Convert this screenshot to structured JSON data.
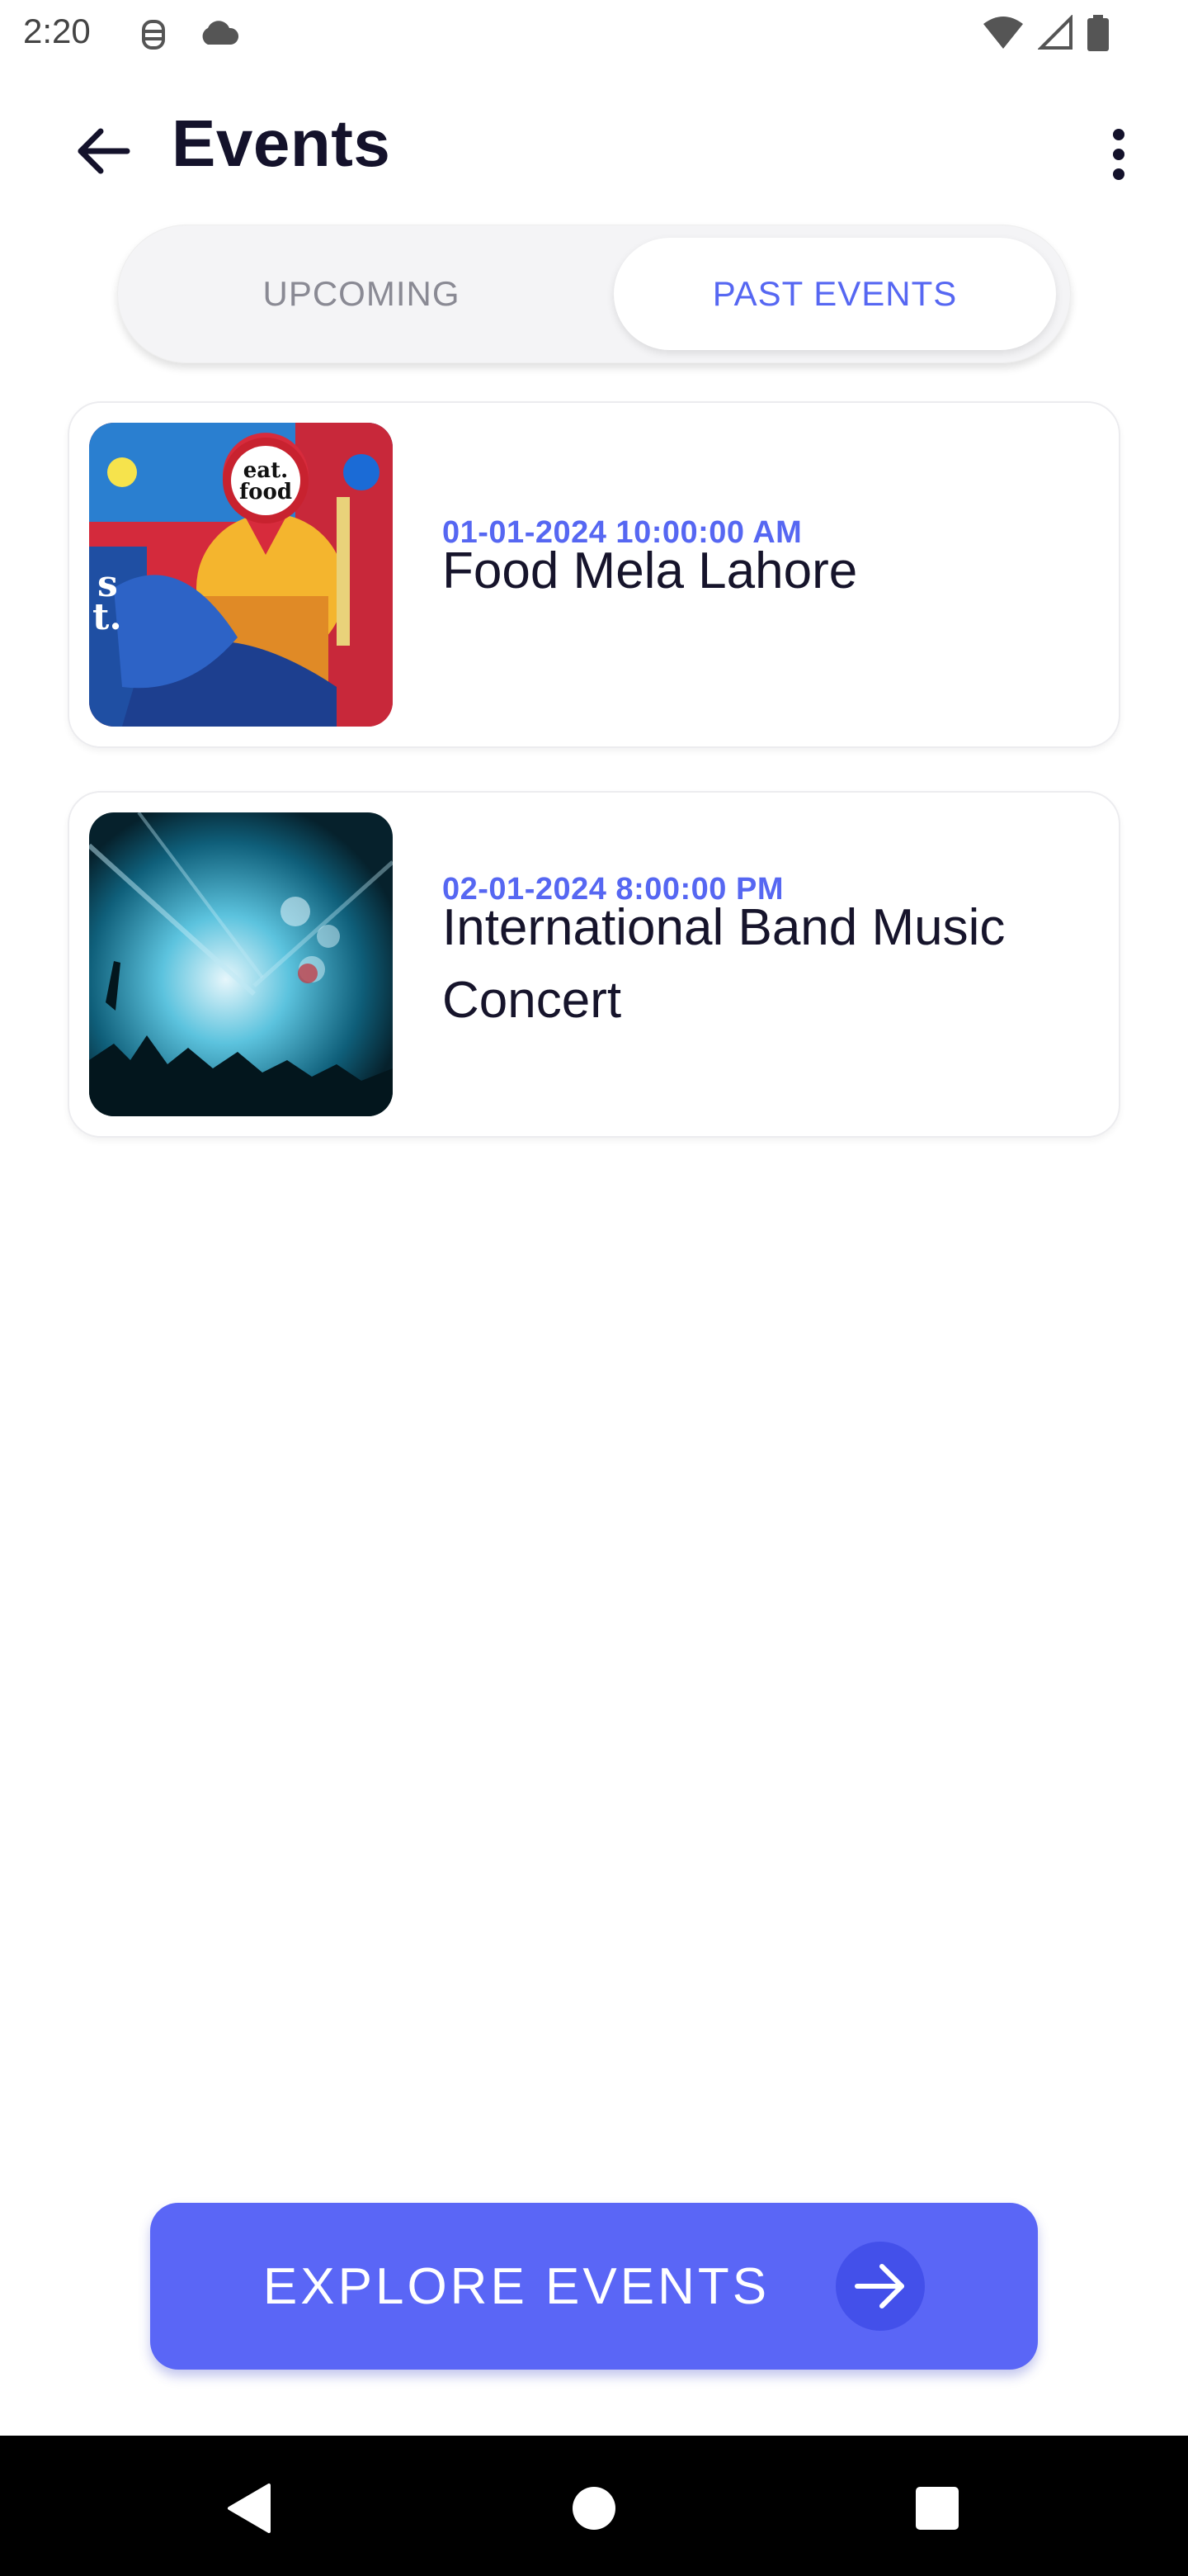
{
  "status_bar": {
    "time": "2:20",
    "icons": [
      "debug-icon",
      "cloud-icon",
      "wifi-icon",
      "signal-icon",
      "battery-icon"
    ]
  },
  "app_bar": {
    "title": "Events",
    "back_icon": "arrow-left-icon",
    "menu_icon": "more-vertical-icon"
  },
  "tabs": [
    {
      "label": "UPCOMING",
      "selected": false
    },
    {
      "label": "PAST EVENTS",
      "selected": true
    }
  ],
  "events": [
    {
      "date": "01-01-2024 10:00:00 AM",
      "name": "Food Mela Lahore",
      "image": "eat-food-festival-poster"
    },
    {
      "date": "02-01-2024 8:00:00 PM",
      "name": "International Band Music Concert",
      "image": "concert-crowd-photo"
    }
  ],
  "explore_button": {
    "label": "EXPLORE EVENTS",
    "icon": "arrow-right-icon"
  },
  "nav_bar": {
    "buttons": [
      "back-triangle-icon",
      "home-circle-icon",
      "recents-square-icon"
    ]
  },
  "colors": {
    "accent": "#5667F2",
    "button": "#5A66F6",
    "title": "#14122B",
    "muted": "#8A8A94"
  }
}
